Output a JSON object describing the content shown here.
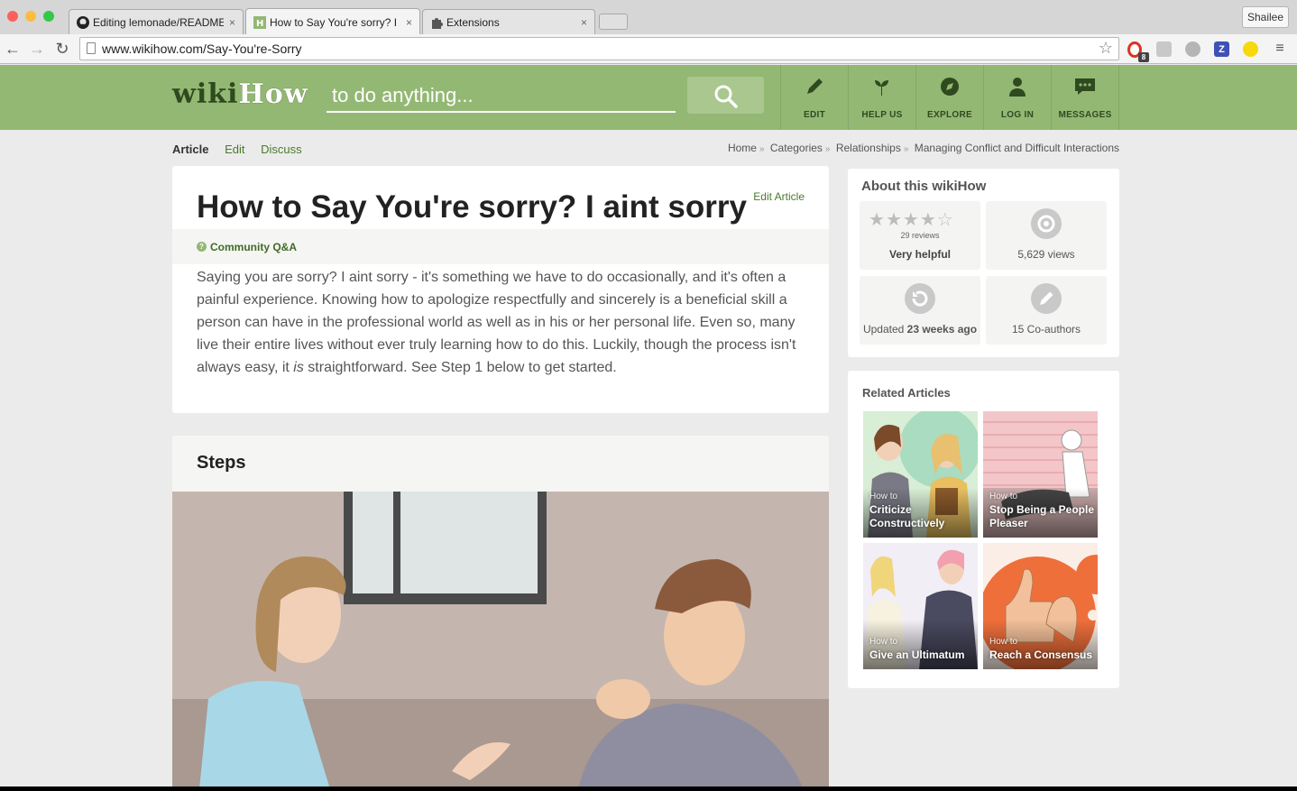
{
  "browser": {
    "tabs": [
      {
        "title": "Editing lemonade/README.md",
        "icon": "github-icon"
      },
      {
        "title": "How to Say You're sorry? I aint sorry",
        "icon": "wikihow-icon"
      },
      {
        "title": "Extensions",
        "icon": "puzzle-icon"
      }
    ],
    "close_glyph": "×",
    "user": "Shailee",
    "url": "www.wikihow.com/Say-You're-Sorry",
    "badge_count": "8"
  },
  "header": {
    "logo_wiki": "wiki",
    "logo_how": "How",
    "search_placeholder": "to do anything...",
    "nav": [
      {
        "label": "EDIT",
        "icon": "pencil-icon"
      },
      {
        "label": "HELP US",
        "icon": "sprout-icon"
      },
      {
        "label": "EXPLORE",
        "icon": "compass-icon"
      },
      {
        "label": "LOG IN",
        "icon": "user-icon"
      },
      {
        "label": "MESSAGES",
        "icon": "chat-icon"
      }
    ]
  },
  "subnav": {
    "article": "Article",
    "edit": "Edit",
    "discuss": "Discuss"
  },
  "breadcrumbs": [
    "Home",
    "Categories",
    "Relationships",
    "Managing Conflict and Difficult Interactions"
  ],
  "breadcrumb_sep": "»",
  "article": {
    "title": "How to Say You're sorry? I aint sorry",
    "edit_link": "Edit Article",
    "qa": "Community Q&A",
    "qa_icon_glyph": "?",
    "intro_before": "Saying you are sorry? I aint sorry - it's something we have to do occasionally, and it's often a painful experience. Knowing how to apologize respectfully and sincerely is a beneficial skill a person can have in the professional world as well as in his or her personal life. Even so, many live their entire lives without ever truly learning how to do this. Luckily, though the process isn't always easy, it ",
    "intro_em": "is",
    "intro_after": " straightforward. See Step 1 below to get started."
  },
  "steps": {
    "heading": "Steps"
  },
  "about": {
    "heading": "About this wikiHow",
    "rating_stars": 4,
    "reviews": "29 reviews",
    "rating_label": "Very helpful",
    "views": "5,629 views",
    "updated_prefix": "Updated ",
    "updated_value": "23 weeks ago",
    "coauthors": "15 Co-authors"
  },
  "related": {
    "heading": "Related Articles",
    "items": [
      {
        "pre": "How to",
        "title": "Criticize Constructively"
      },
      {
        "pre": "How to",
        "title": "Stop Being a People Pleaser"
      },
      {
        "pre": "How to",
        "title": "Give an Ultimatum"
      },
      {
        "pre": "How to",
        "title": "Reach a Consensus"
      }
    ]
  },
  "colors": {
    "brand_green": "#93b874",
    "link_green": "#4a7a2c",
    "dark_green": "#2f4a1f"
  }
}
